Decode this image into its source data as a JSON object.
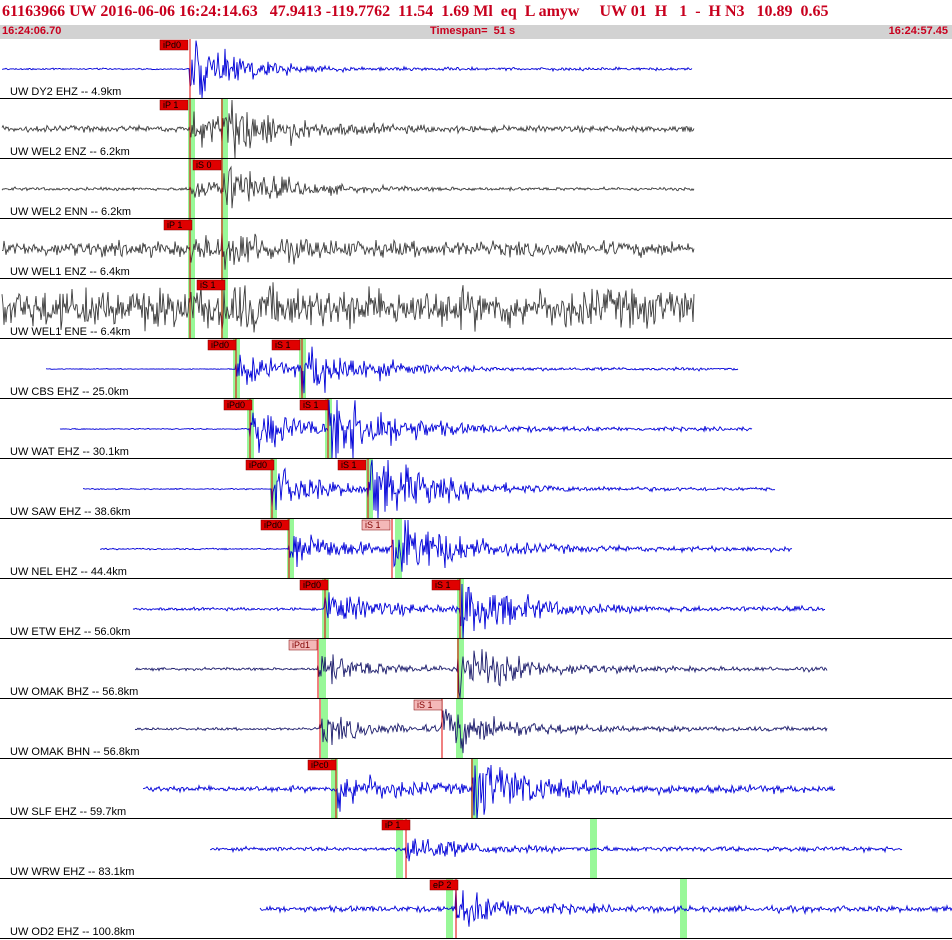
{
  "header": {
    "title": "61163966 UW 2016-06-06 16:24:14.63   47.9413 -119.7762  11.54  1.69 Ml  eq  L amyw     UW 01  H   1  -  H N3   10.89  0.65",
    "start_time": "16:24:06.70",
    "timespan": "Timespan=  51 s",
    "end_time": "16:24:57.45"
  },
  "colors": {
    "title_red": "#c8001e",
    "header_bar": "#d2d2d2",
    "trace_blue": "#0000d8",
    "trace_dark": "#3c3c3c",
    "trace_navy": "#1c1c6c",
    "pick_red": "#e00000",
    "pick_pink": "#f4b8b8",
    "pick_green": "#98f898"
  },
  "traces": [
    {
      "label": "UW DY2 EHZ -- 4.9km",
      "color": "blue",
      "picks": [
        {
          "label": "iPd0",
          "style": "red"
        }
      ]
    },
    {
      "label": "UW WEL2 ENZ -- 6.2km",
      "color": "dark",
      "picks": [
        {
          "label": "iP 1",
          "style": "red"
        }
      ]
    },
    {
      "label": "UW WEL2 ENN -- 6.2km",
      "color": "dark",
      "picks": [
        {
          "label": "iS 0",
          "style": "red"
        }
      ]
    },
    {
      "label": "UW WEL1 ENZ -- 6.4km",
      "color": "dark",
      "picks": [
        {
          "label": "iP 1",
          "style": "red"
        }
      ]
    },
    {
      "label": "UW WEL1 ENE -- 6.4km",
      "color": "dark",
      "picks": [
        {
          "label": "iS 1",
          "style": "red"
        }
      ]
    },
    {
      "label": "UW CBS EHZ -- 25.0km",
      "color": "blue",
      "picks": [
        {
          "label": "iPd0",
          "style": "red"
        },
        {
          "label": "iS 1",
          "style": "red"
        }
      ]
    },
    {
      "label": "UW WAT EHZ -- 30.1km",
      "color": "blue",
      "picks": [
        {
          "label": "iPd0",
          "style": "red"
        },
        {
          "label": "iS 1",
          "style": "red"
        }
      ]
    },
    {
      "label": "UW SAW EHZ -- 38.6km",
      "color": "blue",
      "picks": [
        {
          "label": "iPd0",
          "style": "red"
        },
        {
          "label": "iS 1",
          "style": "red"
        }
      ]
    },
    {
      "label": "UW NEL EHZ -- 44.4km",
      "color": "blue",
      "picks": [
        {
          "label": "iPd0",
          "style": "red"
        },
        {
          "label": "iS 1",
          "style": "pink"
        }
      ]
    },
    {
      "label": "UW ETW EHZ -- 56.0km",
      "color": "blue",
      "picks": [
        {
          "label": "iPd0",
          "style": "red"
        },
        {
          "label": "iS 1",
          "style": "red"
        }
      ]
    },
    {
      "label": "UW OMAK BHZ -- 56.8km",
      "color": "navy",
      "picks": [
        {
          "label": "iPd1",
          "style": "pink"
        }
      ]
    },
    {
      "label": "UW OMAK BHN -- 56.8km",
      "color": "navy",
      "picks": [
        {
          "label": "iS 1",
          "style": "pink"
        }
      ]
    },
    {
      "label": "UW SLF EHZ -- 59.7km",
      "color": "blue",
      "picks": [
        {
          "label": "iPc0",
          "style": "red"
        }
      ]
    },
    {
      "label": "UW WRW EHZ -- 83.1km",
      "color": "blue",
      "picks": [
        {
          "label": "iP 1",
          "style": "red"
        }
      ]
    },
    {
      "label": "UW OD2 EHZ -- 100.8km",
      "color": "blue",
      "picks": [
        {
          "label": "eP 2",
          "style": "red"
        }
      ]
    }
  ]
}
